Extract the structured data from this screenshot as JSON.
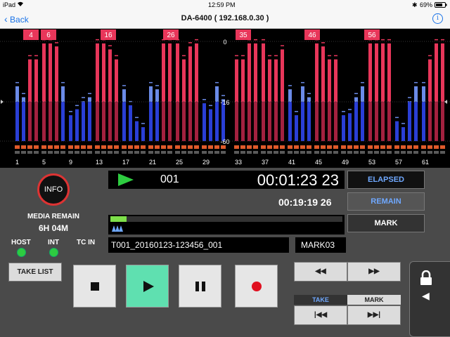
{
  "status": {
    "carrier": "iPad",
    "wifi": "wifi-icon",
    "time": "12:59 PM",
    "battery": "69%"
  },
  "nav": {
    "back_label": "Back",
    "title": "DA-6400 ( 192.168.0.30 )",
    "info": "i"
  },
  "meter": {
    "scale_labels": [
      "0",
      "-16",
      "-60"
    ],
    "track_labels_bottom": [
      "1",
      "5",
      "9",
      "13",
      "17",
      "21",
      "25",
      "29",
      "33",
      "37",
      "41",
      "45",
      "49",
      "53",
      "57",
      "61"
    ],
    "group_labels_top": [
      "4",
      "6",
      "16",
      "26",
      "35",
      "46",
      "56"
    ],
    "group_labels_partial": [
      "2",
      "4"
    ],
    "colors": {
      "red": "#e8365a",
      "red_dark": "#a3213f",
      "blue": "#2a3fd6",
      "blue_light": "#6b8be8",
      "orange": "#e05a2a",
      "gray": "#5a5a5a"
    },
    "levels": [
      0.55,
      0.44,
      0.82,
      0.82,
      0.98,
      0.98,
      0.95,
      0.55,
      0.26,
      0.32,
      0.4,
      0.44,
      0.98,
      0.98,
      0.92,
      0.82,
      0.52,
      0.36,
      0.2,
      0.14,
      0.55,
      0.52,
      0.98,
      0.98,
      0.98,
      0.82,
      0.95,
      0.98,
      0.38,
      0.32,
      0.55,
      0.42,
      0.82,
      0.82,
      0.98,
      0.98,
      0.98,
      0.82,
      0.82,
      0.92,
      0.52,
      0.26,
      0.55,
      0.44,
      0.98,
      0.95,
      0.82,
      0.82,
      0.26,
      0.28,
      0.44,
      0.55,
      0.98,
      0.98,
      0.98,
      0.98,
      0.2,
      0.14,
      0.4,
      0.55,
      0.55,
      0.82,
      0.98,
      0.98
    ]
  },
  "info_button": "INFO",
  "media": {
    "title": "MEDIA REMAIN",
    "value": "6H 04M"
  },
  "indicators": {
    "host": "HOST",
    "int": "INT",
    "tc_in": "TC IN"
  },
  "transport": {
    "play_icon": "play-icon",
    "track": "001",
    "time": "00:01:23 23",
    "remain_time": "00:19:19 26"
  },
  "mode_buttons": {
    "elapsed": "ELAPSED",
    "remain": "REMAIN",
    "mark": "MARK"
  },
  "progress": {
    "value": 0.07
  },
  "file": {
    "name": "T001_20160123-123456_001",
    "mark": "MARK03"
  },
  "take_list": "TAKE LIST",
  "controls": {
    "stop": "stop-icon",
    "play": "play-icon",
    "pause": "pause-icon",
    "record": "record-icon"
  },
  "skip": {
    "rewind": "◀◀",
    "forward": "▶▶",
    "take": "TAKE",
    "mark": "MARK",
    "prev": "|◀◀",
    "next": "▶▶|"
  },
  "lock": {
    "icon": "lock-icon",
    "arrow": "◀"
  }
}
